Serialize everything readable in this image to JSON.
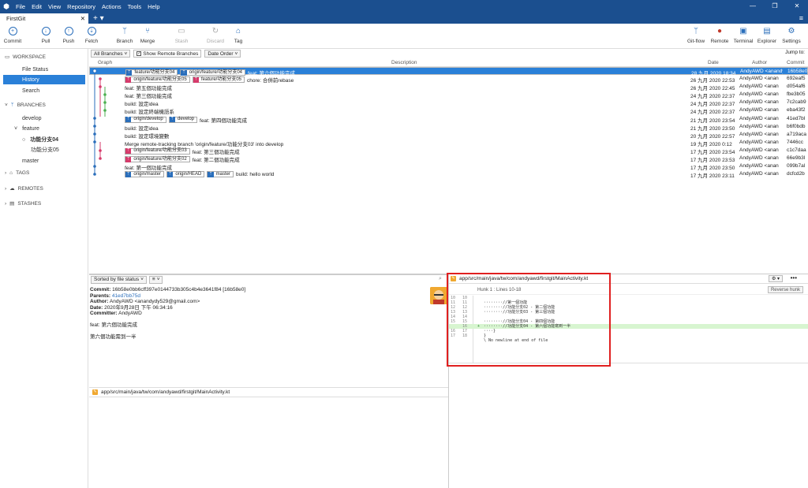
{
  "window": {
    "menu": [
      "File",
      "Edit",
      "View",
      "Repository",
      "Actions",
      "Tools",
      "Help"
    ],
    "controls": [
      "—",
      "❐",
      "✕"
    ]
  },
  "tabs": {
    "active": "FirstGit",
    "close": "✕",
    "plus": "+ ▾",
    "menu": "≡"
  },
  "toolbar": {
    "commit": "Commit",
    "pull": "Pull",
    "push": "Push",
    "fetch": "Fetch",
    "branch": "Branch",
    "merge": "Merge",
    "stash": "Stash",
    "discard": "Discard",
    "tag": "Tag",
    "gitflow": "Git-flow",
    "remote": "Remote",
    "terminal": "Terminal",
    "explorer": "Explorer",
    "settings": "Settings"
  },
  "sidebar": {
    "workspace": "WORKSPACE",
    "file_status": "File Status",
    "history": "History",
    "search": "Search",
    "branches": "BRANCHES",
    "develop": "develop",
    "feature": "feature",
    "feature_04": "功能分支04",
    "feature_05": "功能分支05",
    "master": "master",
    "tags": "TAGS",
    "remotes": "REMOTES",
    "stashes": "STASHES"
  },
  "filter": {
    "all_branches": "All Branches",
    "show_remote": "Show Remote Branches",
    "date_order": "Date Order",
    "jump_to": "Jump to:"
  },
  "columns": {
    "graph": "Graph",
    "description": "Description",
    "date": "Date",
    "author": "Author",
    "commit": "Commit"
  },
  "commits": [
    {
      "refs": [
        {
          "t": "feature/功能分支04",
          "c": "blue"
        },
        {
          "t": "origin/feature/功能分支04",
          "c": "blue"
        }
      ],
      "msg": "feat: 第六個功能完成",
      "date": "28 九月 2020 18:34",
      "author": "AndyAWD <anandydy",
      "hash": "16b58e0"
    },
    {
      "refs": [
        {
          "t": "origin/feature/功能分支05",
          "c": "pink"
        },
        {
          "t": "feature/功能分支05",
          "c": "pink"
        }
      ],
      "msg": "chore: 合併前rebase",
      "date": "26 九月 2020 22:53",
      "author": "AndyAWD <anan",
      "hash": "692eaf5"
    },
    {
      "refs": [],
      "msg": "feat: 第五個功能完成",
      "date": "26 九月 2020 22:45",
      "author": "AndyAWD <anan",
      "hash": "d054af6"
    },
    {
      "refs": [],
      "msg": "feat: 第三個功能完成",
      "date": "24 九月 2020 22:37",
      "author": "AndyAWD <anan",
      "hash": "fbe3b05"
    },
    {
      "refs": [],
      "msg": "build: 設定idea",
      "date": "24 九月 2020 22:37",
      "author": "AndyAWD <anan",
      "hash": "7c2cab9"
    },
    {
      "refs": [],
      "msg": "build: 設定終端機語系",
      "date": "24 九月 2020 22:37",
      "author": "AndyAWD <anan",
      "hash": "eba43f2"
    },
    {
      "refs": [
        {
          "t": "origin/develop",
          "c": "blue"
        },
        {
          "t": "develop",
          "c": "blue"
        }
      ],
      "msg": "feat: 第四個功能完成",
      "date": "21 九月 2020 23:54",
      "author": "AndyAWD <anan",
      "hash": "41ed7bl"
    },
    {
      "refs": [],
      "msg": "build: 設定idea",
      "date": "21 九月 2020 23:50",
      "author": "AndyAWD <anan",
      "hash": "b6f0bdb"
    },
    {
      "refs": [],
      "msg": "build: 設定環境變數",
      "date": "20 九月 2020 22:57",
      "author": "AndyAWD <anan",
      "hash": "a719aca"
    },
    {
      "refs": [],
      "msg": "Merge remote-tracking branch 'origin/feature/功能分支03' into develop",
      "date": "19 九月 2020 0:12",
      "author": "AndyAWD <anan",
      "hash": "7446cc"
    },
    {
      "refs": [
        {
          "t": "origin/feature/功能分支03",
          "c": "pink"
        }
      ],
      "msg": "feat: 第三個功能完成",
      "date": "17 九月 2020 23:54",
      "author": "AndyAWD <anan",
      "hash": "c1c7daa"
    },
    {
      "refs": [
        {
          "t": "origin/feature/功能分支02",
          "c": "pink"
        }
      ],
      "msg": "feat: 第二個功能完成",
      "date": "17 九月 2020 23:53",
      "author": "AndyAWD <anan",
      "hash": "66e9b3l"
    },
    {
      "refs": [],
      "msg": "feat: 第一個功能完成",
      "date": "17 九月 2020 23:50",
      "author": "AndyAWD <anan",
      "hash": "099b7al"
    },
    {
      "refs": [
        {
          "t": "origin/master",
          "c": "blue"
        },
        {
          "t": "origin/HEAD",
          "c": "blue"
        },
        {
          "t": "master",
          "c": "blue"
        }
      ],
      "msg": "build: hello world",
      "date": "17 九月 2020 23:11",
      "author": "AndyAWD <anan",
      "hash": "dcfcd2b"
    }
  ],
  "bottom": {
    "sort": "Sorted by file status",
    "view_mode": "≡",
    "commit_label": "Commit:",
    "commit_value": "16b58e0bb6cff397e0144733b305c4b4e3641f84 [16b58e0]",
    "parents_label": "Parents:",
    "parents_value": "41ed7bb75d",
    "author_label": "Author:",
    "author_value": "AndyAWD <anandydy529@gmail.com>",
    "date_label": "Date:",
    "date_value": "2020年9月28日 下午 06:34:16",
    "committer_label": "Committer:",
    "committer_value": "AndyAWD",
    "message1": "feat: 第六個功能完成",
    "message2": "第六個功能需到一半",
    "file_path": "app/src/main/java/tw/com/andyawd/firstgit/MainActivity.kt"
  },
  "diff": {
    "file_path": "app/src/main/java/tw/com/andyawd/firstgit/MainActivity.kt",
    "hunk": "Hunk 1 : Lines 10-18",
    "reverse": "Reverse hunk",
    "gear": "⚙ ▾",
    "more": "•••",
    "lines": [
      {
        "o": "10",
        "n": "10",
        "m": "",
        "c": "",
        "add": false
      },
      {
        "o": "11",
        "n": "11",
        "m": "",
        "c": "········//第一個功能",
        "add": false
      },
      {
        "o": "12",
        "n": "12",
        "m": "",
        "c": "········//功能分支02 - 第二個功能",
        "add": false
      },
      {
        "o": "13",
        "n": "13",
        "m": "",
        "c": "········//功能分支03 - 第三個功能",
        "add": false
      },
      {
        "o": "14",
        "n": "14",
        "m": "",
        "c": "",
        "add": false
      },
      {
        "o": "15",
        "n": "15",
        "m": "",
        "c": "········//功能分支04 - 第四個功能",
        "add": false
      },
      {
        "o": "",
        "n": "16",
        "m": "+",
        "c": "········//功能分支04 - 第六個功能寫到一半",
        "add": true
      },
      {
        "o": "16",
        "n": "17",
        "m": "",
        "c": "····}",
        "add": false
      },
      {
        "o": "17",
        "n": "18",
        "m": "",
        "c": "}",
        "add": false
      },
      {
        "o": "",
        "n": "",
        "m": "",
        "c": "\\ No newline at end of file",
        "add": false
      }
    ]
  }
}
